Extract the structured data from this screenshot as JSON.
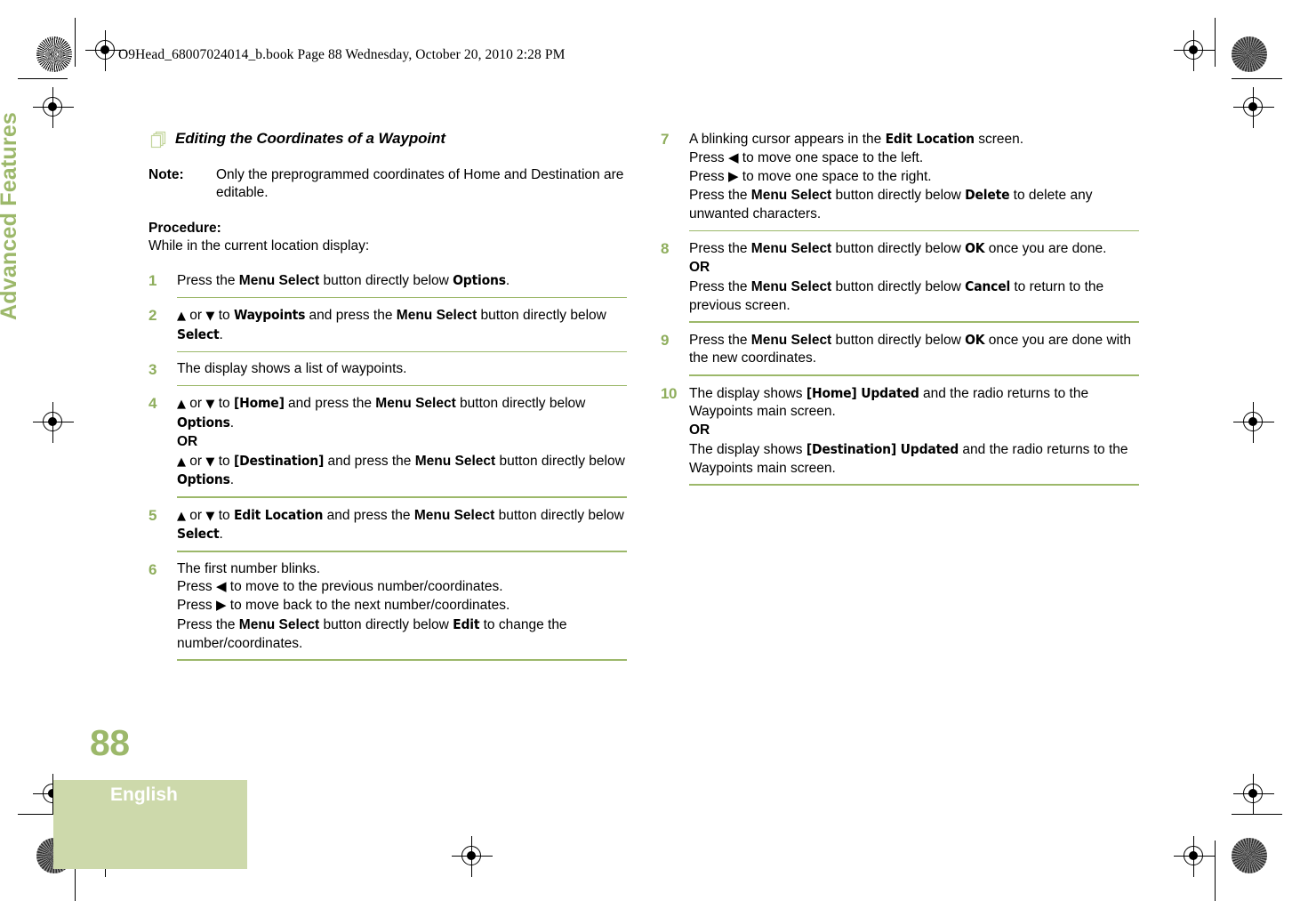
{
  "header": {
    "book_line": "O9Head_68007024014_b.book  Page 88  Wednesday, October 20, 2010  2:28 PM"
  },
  "side_tab": {
    "label": "Advanced Features"
  },
  "footer": {
    "page_number": "88",
    "language": "English"
  },
  "colors": {
    "accent_green": "#9cb86a",
    "number_green": "#8fae5d",
    "band_green": "#cdd9ab"
  },
  "content": {
    "heading": "Editing the Coordinates of a Waypoint",
    "heading_icon": "stacked-pages-icon",
    "note": {
      "label": "Note:",
      "text": "Only the preprogrammed coordinates of Home and Destination are editable."
    },
    "procedure_label": "Procedure:",
    "procedure_intro": "While in the current location display:",
    "nav_up_icon": "▲",
    "nav_down_icon": "▼",
    "nav_left_icon": "◀",
    "nav_right_icon": "▶",
    "or_label": "OR"
  },
  "steps_left": [
    {
      "number": "1",
      "lines": [
        [
          {
            "t": "Press the ",
            "s": "plain"
          },
          {
            "t": "Menu Select",
            "s": "bold"
          },
          {
            "t": " button directly below ",
            "s": "plain"
          },
          {
            "t": "Options",
            "s": "display"
          },
          {
            "t": ".",
            "s": "plain"
          }
        ]
      ]
    },
    {
      "number": "2",
      "lines": [
        [
          {
            "t": "▲",
            "s": "nav"
          },
          {
            "t": " or ",
            "s": "plain"
          },
          {
            "t": "▼",
            "s": "nav"
          },
          {
            "t": " to ",
            "s": "plain"
          },
          {
            "t": "Waypoints",
            "s": "display"
          },
          {
            "t": " and press the ",
            "s": "plain"
          },
          {
            "t": "Menu Select",
            "s": "bold"
          },
          {
            "t": " button directly below ",
            "s": "plain"
          },
          {
            "t": "Select",
            "s": "display"
          },
          {
            "t": ".",
            "s": "plain"
          }
        ]
      ]
    },
    {
      "number": "3",
      "lines": [
        [
          {
            "t": "The display shows a list of waypoints.",
            "s": "plain"
          }
        ]
      ]
    },
    {
      "number": "4",
      "lines": [
        [
          {
            "t": "▲",
            "s": "nav"
          },
          {
            "t": " or ",
            "s": "plain"
          },
          {
            "t": "▼",
            "s": "nav"
          },
          {
            "t": " to ",
            "s": "plain"
          },
          {
            "t": "[Home]",
            "s": "display"
          },
          {
            "t": " and press the ",
            "s": "plain"
          },
          {
            "t": "Menu Select",
            "s": "bold"
          },
          {
            "t": " button directly below ",
            "s": "plain"
          },
          {
            "t": "Options",
            "s": "display"
          },
          {
            "t": ".",
            "s": "plain"
          }
        ],
        [
          {
            "t": "OR",
            "s": "bold"
          }
        ],
        [
          {
            "t": "▲",
            "s": "nav"
          },
          {
            "t": " or ",
            "s": "plain"
          },
          {
            "t": "▼",
            "s": "nav"
          },
          {
            "t": " to ",
            "s": "plain"
          },
          {
            "t": "[Destination]",
            "s": "display"
          },
          {
            "t": " and press the ",
            "s": "plain"
          },
          {
            "t": "Menu Select",
            "s": "bold"
          },
          {
            "t": " button directly below ",
            "s": "plain"
          },
          {
            "t": "Options",
            "s": "display"
          },
          {
            "t": ".",
            "s": "plain"
          }
        ]
      ]
    },
    {
      "number": "5",
      "lines": [
        [
          {
            "t": "▲",
            "s": "nav"
          },
          {
            "t": " or ",
            "s": "plain"
          },
          {
            "t": "▼",
            "s": "nav"
          },
          {
            "t": " to ",
            "s": "plain"
          },
          {
            "t": "Edit Location",
            "s": "display"
          },
          {
            "t": " and press the ",
            "s": "plain"
          },
          {
            "t": "Menu Select",
            "s": "bold"
          },
          {
            "t": " button directly below ",
            "s": "plain"
          },
          {
            "t": "Select",
            "s": "display"
          },
          {
            "t": ".",
            "s": "plain"
          }
        ]
      ]
    },
    {
      "number": "6",
      "lines": [
        [
          {
            "t": "The first number blinks.",
            "s": "plain"
          }
        ],
        [
          {
            "t": "Press ",
            "s": "plain"
          },
          {
            "t": "◀",
            "s": "navlr"
          },
          {
            "t": " to move to the previous number/coordinates.",
            "s": "plain"
          }
        ],
        [
          {
            "t": "Press ",
            "s": "plain"
          },
          {
            "t": "▶",
            "s": "navlr"
          },
          {
            "t": " to move back to the next number/coordinates.",
            "s": "plain"
          }
        ],
        [
          {
            "t": "Press the ",
            "s": "plain"
          },
          {
            "t": "Menu Select",
            "s": "bold"
          },
          {
            "t": " button directly below ",
            "s": "plain"
          },
          {
            "t": "Edit",
            "s": "display"
          },
          {
            "t": " to change the number/coordinates.",
            "s": "plain"
          }
        ]
      ]
    }
  ],
  "steps_right": [
    {
      "number": "7",
      "lines": [
        [
          {
            "t": "A blinking cursor appears in the ",
            "s": "plain"
          },
          {
            "t": "Edit Location",
            "s": "display"
          },
          {
            "t": " screen.",
            "s": "plain"
          }
        ],
        [
          {
            "t": "Press ",
            "s": "plain"
          },
          {
            "t": "◀",
            "s": "navlr"
          },
          {
            "t": " to move one space to the left.",
            "s": "plain"
          }
        ],
        [
          {
            "t": "Press ",
            "s": "plain"
          },
          {
            "t": "▶",
            "s": "navlr"
          },
          {
            "t": " to move one space to the right.",
            "s": "plain"
          }
        ],
        [
          {
            "t": "Press the ",
            "s": "plain"
          },
          {
            "t": "Menu Select",
            "s": "bold"
          },
          {
            "t": " button directly below ",
            "s": "plain"
          },
          {
            "t": "Delete",
            "s": "display"
          },
          {
            "t": " to delete any unwanted characters.",
            "s": "plain"
          }
        ]
      ]
    },
    {
      "number": "8",
      "lines": [
        [
          {
            "t": "Press the ",
            "s": "plain"
          },
          {
            "t": "Menu Select",
            "s": "bold"
          },
          {
            "t": " button directly below ",
            "s": "plain"
          },
          {
            "t": "OK",
            "s": "display"
          },
          {
            "t": " once you are done.",
            "s": "plain"
          }
        ],
        [
          {
            "t": "OR",
            "s": "bold"
          }
        ],
        [
          {
            "t": "Press the ",
            "s": "plain"
          },
          {
            "t": "Menu Select",
            "s": "bold"
          },
          {
            "t": " button directly below ",
            "s": "plain"
          },
          {
            "t": "Cancel",
            "s": "display"
          },
          {
            "t": " to return to the previous screen.",
            "s": "plain"
          }
        ]
      ]
    },
    {
      "number": "9",
      "lines": [
        [
          {
            "t": "Press the ",
            "s": "plain"
          },
          {
            "t": "Menu Select",
            "s": "bold"
          },
          {
            "t": " button directly below ",
            "s": "plain"
          },
          {
            "t": "OK",
            "s": "display"
          },
          {
            "t": " once you are done with the new coordinates.",
            "s": "plain"
          }
        ]
      ]
    },
    {
      "number": "10",
      "lines": [
        [
          {
            "t": "The display shows ",
            "s": "plain"
          },
          {
            "t": "[Home] Updated",
            "s": "display"
          },
          {
            "t": " and the radio returns to the Waypoints main screen.",
            "s": "plain"
          }
        ],
        [
          {
            "t": "OR",
            "s": "bold"
          }
        ],
        [
          {
            "t": "The display shows ",
            "s": "plain"
          },
          {
            "t": "[Destination] Updated",
            "s": "display"
          },
          {
            "t": " and the radio returns to the Waypoints main screen.",
            "s": "plain"
          }
        ]
      ]
    }
  ]
}
